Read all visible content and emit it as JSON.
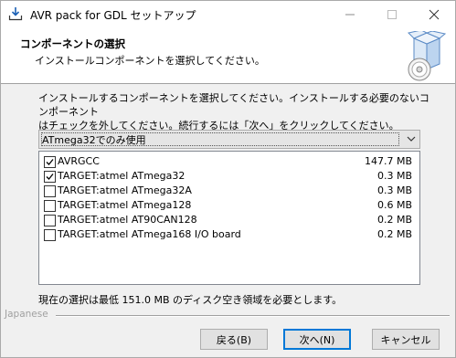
{
  "window": {
    "title": "AVR pack for GDL セットアップ"
  },
  "header": {
    "title": "コンポーネントの選択",
    "subtitle": "インストールコンポーネントを選択してください。"
  },
  "instructions": "インストールするコンポーネントを選択してください。インストールする必要のないコンポーネント\nはチェックを外してください。続行するには「次へ」をクリックしてください。",
  "install_type": {
    "selected": "ATmega32でのみ使用"
  },
  "components": [
    {
      "name": "AVRGCC",
      "size": "147.7 MB",
      "checked": true
    },
    {
      "name": "TARGET:atmel ATmega32",
      "size": "0.3 MB",
      "checked": true
    },
    {
      "name": "TARGET:atmel ATmega32A",
      "size": "0.3 MB",
      "checked": false
    },
    {
      "name": "TARGET:atmel ATmega128",
      "size": "0.6 MB",
      "checked": false
    },
    {
      "name": "TARGET:atmel AT90CAN128",
      "size": "0.2 MB",
      "checked": false
    },
    {
      "name": "TARGET:atmel ATmega168 I/O board",
      "size": "0.2 MB",
      "checked": false
    }
  ],
  "space_required": "現在の選択は最低 151.0 MB のディスク空き領域を必要とします。",
  "language_label": "Japanese",
  "buttons": {
    "back": "戻る(B)",
    "next": "次へ(N)",
    "cancel": "キャンセル"
  },
  "colors": {
    "focus_border": "#0078d7",
    "window_bg": "#f0f0f0"
  }
}
